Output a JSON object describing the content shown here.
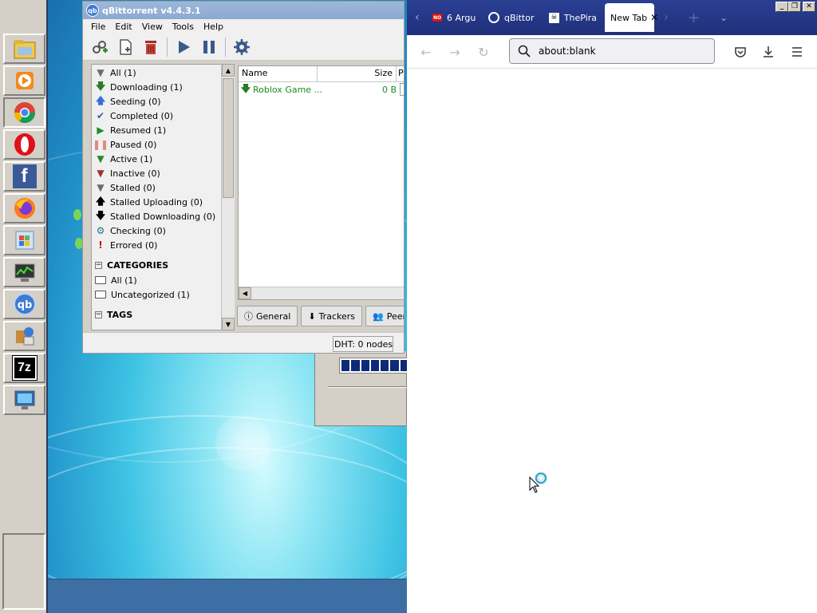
{
  "taskbar": {
    "apps": [
      {
        "name": "File Explorer",
        "icon": "folder-icon"
      },
      {
        "name": "Media Player",
        "icon": "media-player-icon"
      },
      {
        "name": "Google Chrome",
        "icon": "chrome-icon"
      },
      {
        "name": "Opera",
        "icon": "opera-icon"
      },
      {
        "name": "Facebook",
        "icon": "facebook-icon"
      },
      {
        "name": "Firefox",
        "icon": "firefox-icon"
      },
      {
        "name": "Windows Update",
        "icon": "windows-update-icon"
      },
      {
        "name": "Task Manager",
        "icon": "task-manager-icon"
      },
      {
        "name": "qBittorrent",
        "icon": "qbittorrent-icon"
      },
      {
        "name": "Installer",
        "icon": "installer-icon"
      },
      {
        "name": "7-Zip",
        "icon": "7zip-icon",
        "label": "7z"
      },
      {
        "name": "Remote Desktop",
        "icon": "remote-desktop-icon"
      }
    ]
  },
  "qbt": {
    "title": "qBittorrent v4.4.3.1",
    "logo_text": "qb",
    "menu": [
      "File",
      "Edit",
      "View",
      "Tools",
      "Help"
    ],
    "status_filters": [
      {
        "label": "All (1)",
        "icon": "filter-icon",
        "color": "#6b6b6b"
      },
      {
        "label": "Downloading (1)",
        "icon": "arrow-down-icon",
        "color": "#2a7a2a"
      },
      {
        "label": "Seeding (0)",
        "icon": "arrow-up-icon",
        "color": "#3a6fd8"
      },
      {
        "label": "Completed (0)",
        "icon": "checkmark-icon",
        "color": "#3a5a9a"
      },
      {
        "label": "Resumed (1)",
        "icon": "play-icon",
        "color": "#2a8a2a"
      },
      {
        "label": "Paused (0)",
        "icon": "pause-icon",
        "color": "#e28a7a"
      },
      {
        "label": "Active (1)",
        "icon": "filter-green-icon",
        "color": "#2a8a2a"
      },
      {
        "label": "Inactive (0)",
        "icon": "filter-red-icon",
        "color": "#a03030"
      },
      {
        "label": "Stalled (0)",
        "icon": "filter-gray-icon",
        "color": "#6b6b6b"
      },
      {
        "label": "Stalled Uploading (0)",
        "icon": "arrow-up-black-icon",
        "color": "#000000"
      },
      {
        "label": "Stalled Downloading (0)",
        "icon": "arrow-down-black-icon",
        "color": "#000000"
      },
      {
        "label": "Checking (0)",
        "icon": "gear-icon",
        "color": "#1e7a8a"
      },
      {
        "label": "Errored (0)",
        "icon": "exclamation-icon",
        "color": "#d01010"
      }
    ],
    "categories_header": "CATEGORIES",
    "categories": [
      "All (1)",
      "Uncategorized (1)"
    ],
    "tags_header": "TAGS",
    "columns": {
      "name": "Name",
      "size": "Size",
      "extra": "P"
    },
    "torrents": [
      {
        "name": "Roblox Game ...",
        "size": "0 B"
      }
    ],
    "tabs": [
      "General",
      "Trackers",
      "Peer"
    ],
    "dht": "DHT: 0 nodes"
  },
  "firefox": {
    "tabs": [
      {
        "label": "6 Argu",
        "icon": "red-favicon"
      },
      {
        "label": "qBittor",
        "icon": "search-favicon"
      },
      {
        "label": "ThePira",
        "icon": "pirate-favicon"
      }
    ],
    "active_tab": "New Tab",
    "url": "about:blank"
  }
}
